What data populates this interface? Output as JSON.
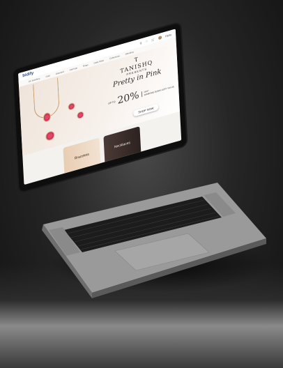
{
  "site": {
    "logo": "bidify",
    "top_icons": [
      "search-icon",
      "heart-icon",
      "cart-icon",
      "user-icon"
    ],
    "user_label": "Hello",
    "menu": [
      "All Jewellery",
      "Gold",
      "Diamond",
      "Earrings",
      "Rings",
      "Daily Wear",
      "Collections",
      "Wedding",
      "Gifting",
      "Golden Harvest"
    ]
  },
  "banner": {
    "brand_mark": "Ⲧ",
    "brand_name": "TANISHQ",
    "presents": "PRESENTS",
    "headline": "Pretty in Pink",
    "up_to": "UP TO",
    "percent": "20%",
    "off": "OFF*",
    "offer_text": "DIAMOND JEWELLERY VALUE",
    "cta": "SHOP NOW"
  },
  "categories": [
    {
      "label": "Bracelets"
    },
    {
      "label": "Necklaces"
    }
  ],
  "colors": {
    "accent": "#2b4a7a",
    "gem": "#e4476a"
  }
}
